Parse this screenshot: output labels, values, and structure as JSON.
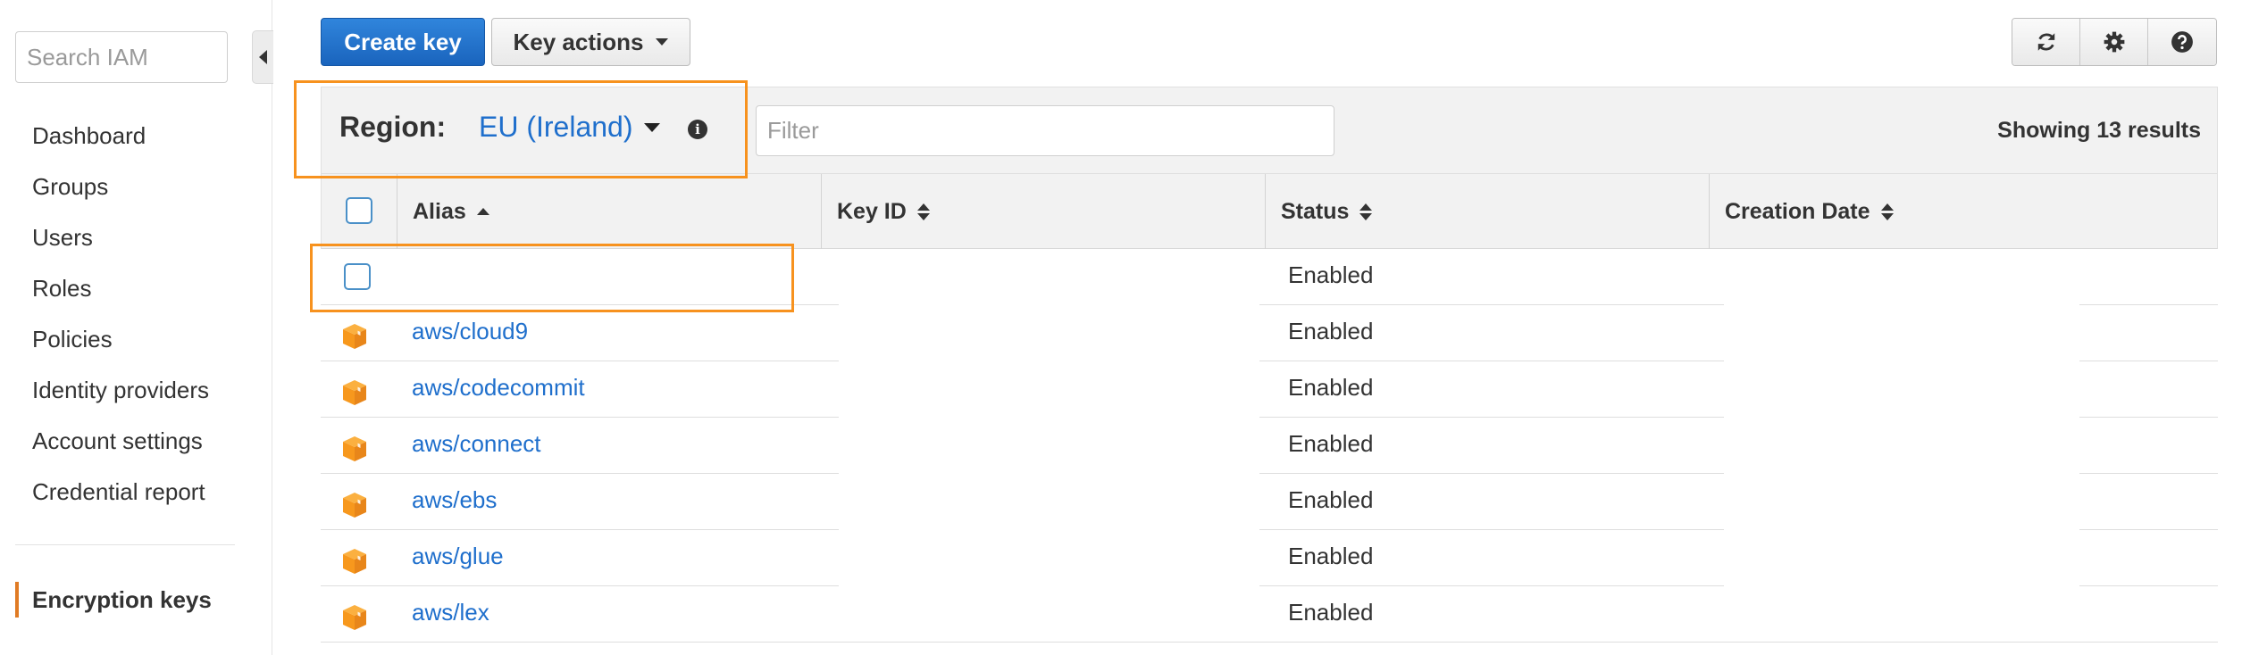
{
  "sidebar": {
    "search_placeholder": "Search IAM",
    "items": [
      {
        "label": "Dashboard"
      },
      {
        "label": "Groups"
      },
      {
        "label": "Users"
      },
      {
        "label": "Roles"
      },
      {
        "label": "Policies"
      },
      {
        "label": "Identity providers"
      },
      {
        "label": "Account settings"
      },
      {
        "label": "Credential report"
      }
    ],
    "active_item": "Encryption keys"
  },
  "toolbar": {
    "create_key_label": "Create key",
    "key_actions_label": "Key actions",
    "icons": [
      "refresh-icon",
      "gear-icon",
      "help-icon"
    ]
  },
  "panel": {
    "region_label": "Region:",
    "region_value": "EU (Ireland)",
    "filter_placeholder": "Filter",
    "results_text": "Showing 13 results"
  },
  "table": {
    "columns": [
      "Alias",
      "Key ID",
      "Status",
      "Creation Date"
    ],
    "sorted_column": "Alias",
    "rows": [
      {
        "alias": "",
        "status": "Enabled",
        "aws_managed": false
      },
      {
        "alias": "aws/cloud9",
        "status": "Enabled",
        "aws_managed": true
      },
      {
        "alias": "aws/codecommit",
        "status": "Enabled",
        "aws_managed": true
      },
      {
        "alias": "aws/connect",
        "status": "Enabled",
        "aws_managed": true
      },
      {
        "alias": "aws/ebs",
        "status": "Enabled",
        "aws_managed": true
      },
      {
        "alias": "aws/glue",
        "status": "Enabled",
        "aws_managed": true
      },
      {
        "alias": "aws/lex",
        "status": "Enabled",
        "aws_managed": true
      }
    ]
  },
  "colors": {
    "accent_blue": "#1f6fcc",
    "highlight_orange": "#f7921e",
    "active_bar": "#e07b24",
    "aws_cube": "#f7981d"
  }
}
